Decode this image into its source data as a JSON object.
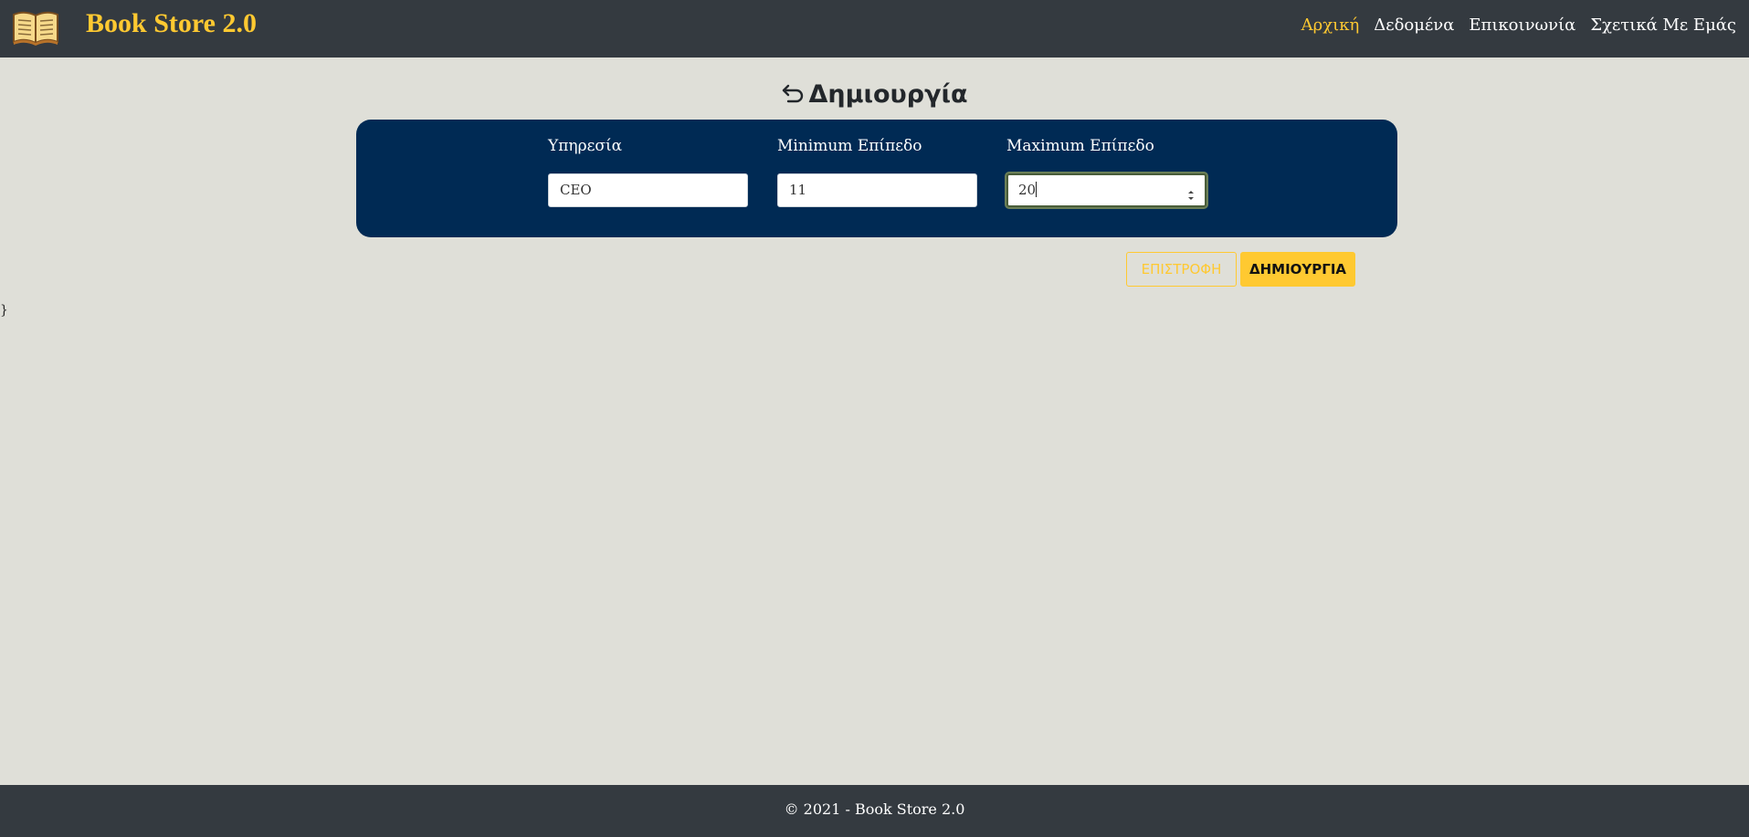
{
  "app": {
    "brand_title": "Book Store 2.0",
    "logo_icon": "open-book-icon"
  },
  "nav": {
    "items": [
      {
        "label": "Αρχική",
        "active": true
      },
      {
        "label": "Δεδομένα",
        "active": false
      },
      {
        "label": "Επικοινωνία",
        "active": false
      },
      {
        "label": "Σχετικά Με Εμάς",
        "active": false
      }
    ]
  },
  "page": {
    "heading": "Δημιουργία",
    "back_icon": "return-arrow-icon"
  },
  "form": {
    "fields": [
      {
        "label": "Υπηρεσία",
        "value": "CEO"
      },
      {
        "label": "Minimum Επίπεδο",
        "value": "11"
      },
      {
        "label": "Maximum Επίπεδο",
        "value": "20"
      }
    ]
  },
  "actions": {
    "back_label": "ΕΠΙΣΤΡΟΦΗ",
    "create_label": "ΔΗΜΙΟΥΡΓΙΑ"
  },
  "stray_text": "}",
  "footer": {
    "text": "© 2021 - Book Store 2.0"
  },
  "colors": {
    "accent": "#ffc931",
    "navbar": "#343a40",
    "panel": "#002a54",
    "background": "#dfdfd8"
  }
}
